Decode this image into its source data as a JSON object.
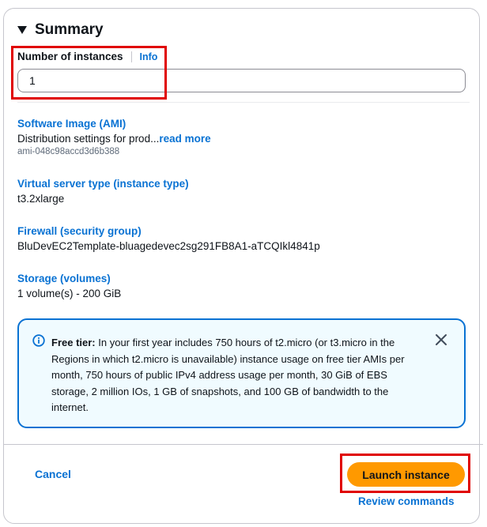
{
  "summary": {
    "title": "Summary",
    "instances_label": "Number of instances",
    "info_link": "Info",
    "instances_value": "1",
    "ami": {
      "label": "Software Image (AMI)",
      "description": "Distribution settings for prod...",
      "read_more": "read more",
      "id": "ami-048c98accd3d6b388"
    },
    "instance_type": {
      "label": "Virtual server type (instance type)",
      "value": "t3.2xlarge"
    },
    "firewall": {
      "label": "Firewall (security group)",
      "value": "BluDevEC2Template-bluagedevec2sg291FB8A1-aTCQIkl4841p"
    },
    "storage": {
      "label": "Storage (volumes)",
      "value": "1 volume(s) - 200 GiB"
    },
    "free_tier": {
      "title": "Free tier:",
      "text": "In your first year includes 750 hours of t2.micro (or t3.micro in the Regions in which t2.micro is unavailable) instance usage on free tier AMIs per month, 750 hours of public IPv4 address usage per month, 30 GiB of EBS storage, 2 million IOs, 1 GB of snapshots, and 100 GB of bandwidth to the internet."
    }
  },
  "footer": {
    "cancel": "Cancel",
    "launch": "Launch instance",
    "review": "Review commands"
  },
  "colors": {
    "link": "#0972d3",
    "primary_button": "#ff9900",
    "alert_bg": "#f0fbff",
    "highlight": "#e00000"
  }
}
